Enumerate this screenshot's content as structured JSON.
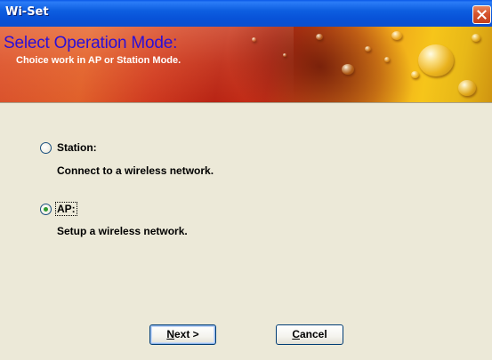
{
  "window": {
    "title": "Wi-Set"
  },
  "banner": {
    "heading": "Select Operation Mode:",
    "subheading": "Choice work in AP or Station Mode."
  },
  "options": [
    {
      "label": "Station:",
      "description": "Connect to a wireless network.",
      "selected": false
    },
    {
      "label": "AP:",
      "description": "Setup a wireless network.",
      "selected": true
    }
  ],
  "buttons": {
    "next_label": "Next >",
    "next_mnemonic": "N",
    "next_rest": "ext >",
    "cancel_label": "Cancel",
    "cancel_mnemonic": "C",
    "cancel_rest": "ancel"
  },
  "icons": {
    "close": "close-icon"
  },
  "colors": {
    "title_bar": "#0a58e8",
    "heading_text": "#2c10d6",
    "close_button": "#d6542d",
    "radio_dot": "#2f9b2f",
    "window_bg": "#ece9d8"
  }
}
